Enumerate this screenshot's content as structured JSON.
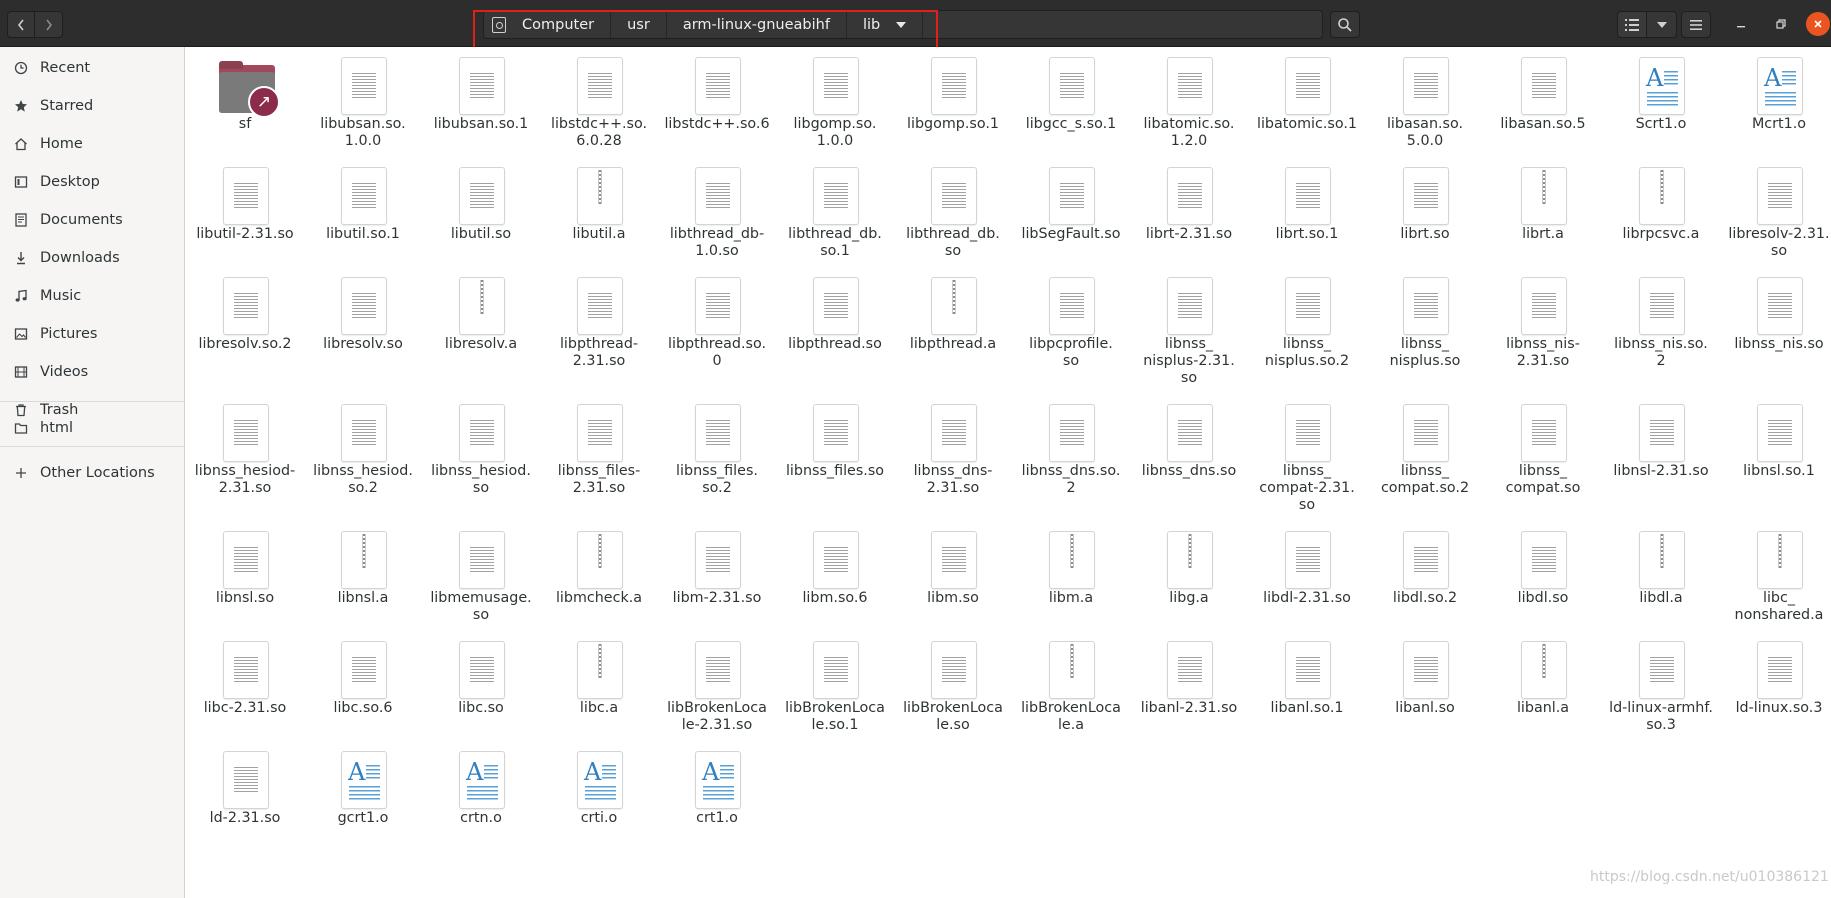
{
  "header": {
    "back_icon": "chevron-left-icon",
    "forward_icon": "chevron-right-icon",
    "path": [
      {
        "label": "Computer",
        "icon": "drive-icon"
      },
      {
        "label": "usr"
      },
      {
        "label": "arm-linux-gnueabihf"
      },
      {
        "label": "lib",
        "has_dropdown": true
      }
    ],
    "highlight_color": "#e0201b"
  },
  "sidebar": {
    "groups": [
      [
        {
          "label": "Recent",
          "icon": "clock-icon"
        },
        {
          "label": "Starred",
          "icon": "star-icon"
        },
        {
          "label": "Home",
          "icon": "home-icon"
        },
        {
          "label": "Desktop",
          "icon": "desktop-icon"
        },
        {
          "label": "Documents",
          "icon": "document-icon"
        },
        {
          "label": "Downloads",
          "icon": "download-icon"
        },
        {
          "label": "Music",
          "icon": "music-icon"
        },
        {
          "label": "Pictures",
          "icon": "picture-icon"
        },
        {
          "label": "Videos",
          "icon": "video-icon"
        },
        {
          "label": "Trash",
          "icon": "trash-icon"
        }
      ],
      [
        {
          "label": "html",
          "icon": "folder-icon"
        }
      ],
      [
        {
          "label": "Other Locations",
          "icon": "plus-icon"
        }
      ]
    ]
  },
  "files": [
    {
      "name": "sf",
      "lines": [
        "sf"
      ],
      "kind": "folder-link"
    },
    {
      "name": "libubsan.so.1.0.0",
      "lines": [
        "libubsan.so.",
        "1.0.0"
      ],
      "kind": "binary"
    },
    {
      "name": "libubsan.so.1",
      "lines": [
        "libubsan.so.1"
      ],
      "kind": "binary"
    },
    {
      "name": "libstdc++.so.6.0.28",
      "lines": [
        "libstdc++.so.",
        "6.0.28"
      ],
      "kind": "binary"
    },
    {
      "name": "libstdc++.so.6",
      "lines": [
        "libstdc++.so.6"
      ],
      "kind": "binary"
    },
    {
      "name": "libgomp.so.1.0.0",
      "lines": [
        "libgomp.so.",
        "1.0.0"
      ],
      "kind": "binary"
    },
    {
      "name": "libgomp.so.1",
      "lines": [
        "libgomp.so.1"
      ],
      "kind": "binary"
    },
    {
      "name": "libgcc_s.so.1",
      "lines": [
        "libgcc_s.so.1"
      ],
      "kind": "binary"
    },
    {
      "name": "libatomic.so.1.2.0",
      "lines": [
        "libatomic.so.",
        "1.2.0"
      ],
      "kind": "binary"
    },
    {
      "name": "libatomic.so.1",
      "lines": [
        "libatomic.so.1"
      ],
      "kind": "binary"
    },
    {
      "name": "libasan.so.5.0.0",
      "lines": [
        "libasan.so.",
        "5.0.0"
      ],
      "kind": "binary"
    },
    {
      "name": "libasan.so.5",
      "lines": [
        "libasan.so.5"
      ],
      "kind": "binary"
    },
    {
      "name": "Scrt1.o",
      "lines": [
        "Scrt1.o"
      ],
      "kind": "text"
    },
    {
      "name": "Mcrt1.o",
      "lines": [
        "Mcrt1.o"
      ],
      "kind": "text"
    },
    {
      "name": "libutil-2.31.so",
      "lines": [
        "libutil-2.31.so"
      ],
      "kind": "binary"
    },
    {
      "name": "libutil.so.1",
      "lines": [
        "libutil.so.1"
      ],
      "kind": "binary"
    },
    {
      "name": "libutil.so",
      "lines": [
        "libutil.so"
      ],
      "kind": "binary"
    },
    {
      "name": "libutil.a",
      "lines": [
        "libutil.a"
      ],
      "kind": "archive"
    },
    {
      "name": "libthread_db-1.0.so",
      "lines": [
        "libthread_db-",
        "1.0.so"
      ],
      "kind": "binary"
    },
    {
      "name": "libthread_db.so.1",
      "lines": [
        "libthread_db.",
        "so.1"
      ],
      "kind": "binary"
    },
    {
      "name": "libthread_db.so",
      "lines": [
        "libthread_db.",
        "so"
      ],
      "kind": "binary"
    },
    {
      "name": "libSegFault.so",
      "lines": [
        "libSegFault.so"
      ],
      "kind": "binary"
    },
    {
      "name": "librt-2.31.so",
      "lines": [
        "librt-2.31.so"
      ],
      "kind": "binary"
    },
    {
      "name": "librt.so.1",
      "lines": [
        "librt.so.1"
      ],
      "kind": "binary"
    },
    {
      "name": "librt.so",
      "lines": [
        "librt.so"
      ],
      "kind": "binary"
    },
    {
      "name": "librt.a",
      "lines": [
        "librt.a"
      ],
      "kind": "archive"
    },
    {
      "name": "librpcsvc.a",
      "lines": [
        "librpcsvc.a"
      ],
      "kind": "archive"
    },
    {
      "name": "libresolv-2.31.so",
      "lines": [
        "libresolv-2.31.",
        "so"
      ],
      "kind": "binary"
    },
    {
      "name": "libresolv.so.2",
      "lines": [
        "libresolv.so.2"
      ],
      "kind": "binary"
    },
    {
      "name": "libresolv.so",
      "lines": [
        "libresolv.so"
      ],
      "kind": "binary"
    },
    {
      "name": "libresolv.a",
      "lines": [
        "libresolv.a"
      ],
      "kind": "archive"
    },
    {
      "name": "libpthread-2.31.so",
      "lines": [
        "libpthread-",
        "2.31.so"
      ],
      "kind": "binary"
    },
    {
      "name": "libpthread.so.0",
      "lines": [
        "libpthread.so.",
        "0"
      ],
      "kind": "binary"
    },
    {
      "name": "libpthread.so",
      "lines": [
        "libpthread.so"
      ],
      "kind": "binary"
    },
    {
      "name": "libpthread.a",
      "lines": [
        "libpthread.a"
      ],
      "kind": "archive"
    },
    {
      "name": "libpcprofile.so",
      "lines": [
        "libpcprofile.",
        "so"
      ],
      "kind": "binary"
    },
    {
      "name": "libnss_nisplus-2.31.so",
      "lines": [
        "libnss_",
        "nisplus-2.31.",
        "so"
      ],
      "kind": "binary"
    },
    {
      "name": "libnss_nisplus.so.2",
      "lines": [
        "libnss_",
        "nisplus.so.2"
      ],
      "kind": "binary"
    },
    {
      "name": "libnss_nisplus.so",
      "lines": [
        "libnss_",
        "nisplus.so"
      ],
      "kind": "binary"
    },
    {
      "name": "libnss_nis-2.31.so",
      "lines": [
        "libnss_nis-",
        "2.31.so"
      ],
      "kind": "binary"
    },
    {
      "name": "libnss_nis.so.2",
      "lines": [
        "libnss_nis.so.",
        "2"
      ],
      "kind": "binary"
    },
    {
      "name": "libnss_nis.so",
      "lines": [
        "libnss_nis.so"
      ],
      "kind": "binary"
    },
    {
      "name": "libnss_hesiod-2.31.so",
      "lines": [
        "libnss_hesiod-",
        "2.31.so"
      ],
      "kind": "binary"
    },
    {
      "name": "libnss_hesiod.so.2",
      "lines": [
        "libnss_hesiod.",
        "so.2"
      ],
      "kind": "binary"
    },
    {
      "name": "libnss_hesiod.so",
      "lines": [
        "libnss_hesiod.",
        "so"
      ],
      "kind": "binary"
    },
    {
      "name": "libnss_files-2.31.so",
      "lines": [
        "libnss_files-",
        "2.31.so"
      ],
      "kind": "binary"
    },
    {
      "name": "libnss_files.so.2",
      "lines": [
        "libnss_files.",
        "so.2"
      ],
      "kind": "binary"
    },
    {
      "name": "libnss_files.so",
      "lines": [
        "libnss_files.so"
      ],
      "kind": "binary"
    },
    {
      "name": "libnss_dns-2.31.so",
      "lines": [
        "libnss_dns-",
        "2.31.so"
      ],
      "kind": "binary"
    },
    {
      "name": "libnss_dns.so.2",
      "lines": [
        "libnss_dns.so.",
        "2"
      ],
      "kind": "binary"
    },
    {
      "name": "libnss_dns.so",
      "lines": [
        "libnss_dns.so"
      ],
      "kind": "binary"
    },
    {
      "name": "libnss_compat-2.31.so",
      "lines": [
        "libnss_",
        "compat-2.31.",
        "so"
      ],
      "kind": "binary"
    },
    {
      "name": "libnss_compat.so.2",
      "lines": [
        "libnss_",
        "compat.so.2"
      ],
      "kind": "binary"
    },
    {
      "name": "libnss_compat.so",
      "lines": [
        "libnss_",
        "compat.so"
      ],
      "kind": "binary"
    },
    {
      "name": "libnsl-2.31.so",
      "lines": [
        "libnsl-2.31.so"
      ],
      "kind": "binary"
    },
    {
      "name": "libnsl.so.1",
      "lines": [
        "libnsl.so.1"
      ],
      "kind": "binary"
    },
    {
      "name": "libnsl.so",
      "lines": [
        "libnsl.so"
      ],
      "kind": "binary"
    },
    {
      "name": "libnsl.a",
      "lines": [
        "libnsl.a"
      ],
      "kind": "archive"
    },
    {
      "name": "libmemusage.so",
      "lines": [
        "libmemusage.",
        "so"
      ],
      "kind": "binary"
    },
    {
      "name": "libmcheck.a",
      "lines": [
        "libmcheck.a"
      ],
      "kind": "archive"
    },
    {
      "name": "libm-2.31.so",
      "lines": [
        "libm-2.31.so"
      ],
      "kind": "binary"
    },
    {
      "name": "libm.so.6",
      "lines": [
        "libm.so.6"
      ],
      "kind": "binary"
    },
    {
      "name": "libm.so",
      "lines": [
        "libm.so"
      ],
      "kind": "binary"
    },
    {
      "name": "libm.a",
      "lines": [
        "libm.a"
      ],
      "kind": "archive"
    },
    {
      "name": "libg.a",
      "lines": [
        "libg.a"
      ],
      "kind": "archive"
    },
    {
      "name": "libdl-2.31.so",
      "lines": [
        "libdl-2.31.so"
      ],
      "kind": "binary"
    },
    {
      "name": "libdl.so.2",
      "lines": [
        "libdl.so.2"
      ],
      "kind": "binary"
    },
    {
      "name": "libdl.so",
      "lines": [
        "libdl.so"
      ],
      "kind": "binary"
    },
    {
      "name": "libdl.a",
      "lines": [
        "libdl.a"
      ],
      "kind": "archive"
    },
    {
      "name": "libc_nonshared.a",
      "lines": [
        "libc_",
        "nonshared.a"
      ],
      "kind": "archive"
    },
    {
      "name": "libc-2.31.so",
      "lines": [
        "libc-2.31.so"
      ],
      "kind": "binary"
    },
    {
      "name": "libc.so.6",
      "lines": [
        "libc.so.6"
      ],
      "kind": "binary"
    },
    {
      "name": "libc.so",
      "lines": [
        "libc.so"
      ],
      "kind": "binary"
    },
    {
      "name": "libc.a",
      "lines": [
        "libc.a"
      ],
      "kind": "archive"
    },
    {
      "name": "libBrokenLocale-2.31.so",
      "lines": [
        "libBrokenLoca",
        "le-2.31.so"
      ],
      "kind": "binary"
    },
    {
      "name": "libBrokenLocale.so.1",
      "lines": [
        "libBrokenLoca",
        "le.so.1"
      ],
      "kind": "binary"
    },
    {
      "name": "libBrokenLocale.so",
      "lines": [
        "libBrokenLoca",
        "le.so"
      ],
      "kind": "binary"
    },
    {
      "name": "libBrokenLocale.a",
      "lines": [
        "libBrokenLoca",
        "le.a"
      ],
      "kind": "archive"
    },
    {
      "name": "libanl-2.31.so",
      "lines": [
        "libanl-2.31.so"
      ],
      "kind": "binary"
    },
    {
      "name": "libanl.so.1",
      "lines": [
        "libanl.so.1"
      ],
      "kind": "binary"
    },
    {
      "name": "libanl.so",
      "lines": [
        "libanl.so"
      ],
      "kind": "binary"
    },
    {
      "name": "libanl.a",
      "lines": [
        "libanl.a"
      ],
      "kind": "archive"
    },
    {
      "name": "ld-linux-armhf.so.3",
      "lines": [
        "ld-linux-armhf.",
        "so.3"
      ],
      "kind": "binary"
    },
    {
      "name": "ld-linux.so.3",
      "lines": [
        "ld-linux.so.3"
      ],
      "kind": "binary"
    },
    {
      "name": "ld-2.31.so",
      "lines": [
        "ld-2.31.so"
      ],
      "kind": "binary"
    },
    {
      "name": "gcrt1.o",
      "lines": [
        "gcrt1.o"
      ],
      "kind": "text"
    },
    {
      "name": "crtn.o",
      "lines": [
        "crtn.o"
      ],
      "kind": "text"
    },
    {
      "name": "crti.o",
      "lines": [
        "crti.o"
      ],
      "kind": "text"
    },
    {
      "name": "crt1.o",
      "lines": [
        "crt1.o"
      ],
      "kind": "text"
    }
  ],
  "watermark": "https://blog.csdn.net/u010386121"
}
